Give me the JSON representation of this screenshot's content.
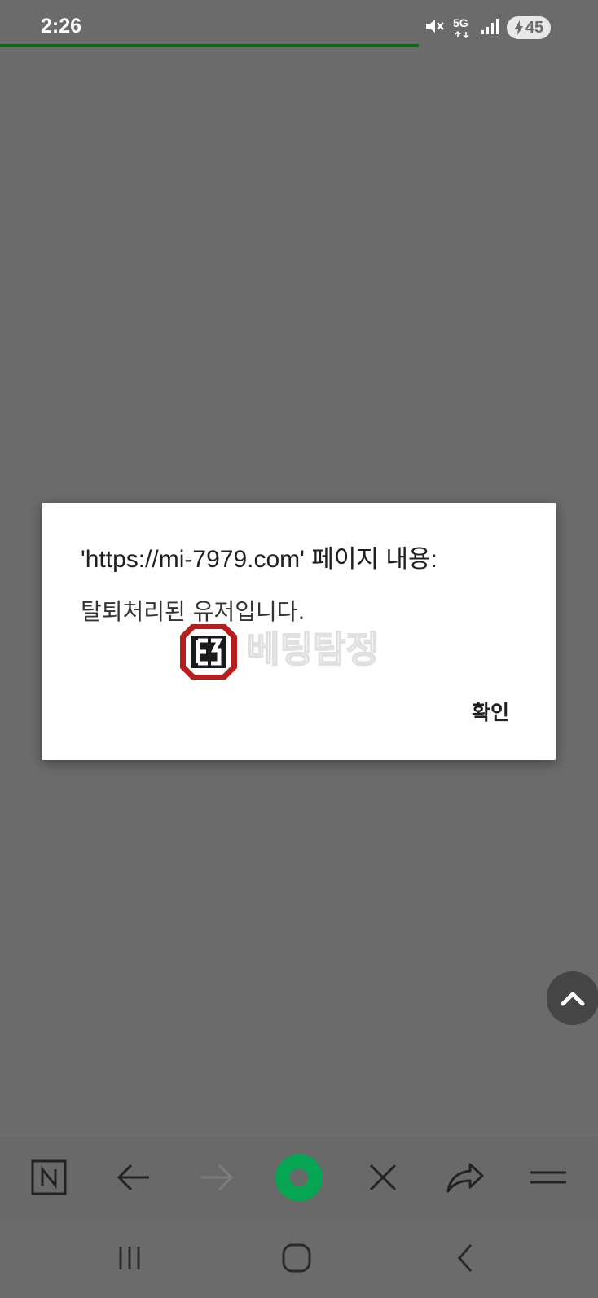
{
  "status_bar": {
    "time": "2:26",
    "network": "5G",
    "battery": "45",
    "icons": [
      "mute-icon",
      "5g-icon",
      "signal-icon",
      "battery-charging-icon"
    ]
  },
  "dialog": {
    "title": "'https://mi-7979.com' 페이지 내용:",
    "message": "탈퇴처리된 유저입니다.",
    "confirm_label": "확인",
    "watermark_text": "베팅탐정"
  },
  "toolbar": {
    "icons": [
      "naver-n-icon",
      "back-arrow-icon",
      "forward-arrow-icon",
      "home-ring-icon",
      "close-icon",
      "share-icon",
      "menu-icon"
    ]
  },
  "nav_bar": {
    "icons": [
      "recent-apps-icon",
      "home-icon",
      "back-icon"
    ]
  },
  "colors": {
    "background": "#6b6b6b",
    "progress": "#0a6b12",
    "accent_green": "#05a553",
    "dialog_bg": "#ffffff",
    "logo_red": "#b51f1f"
  }
}
